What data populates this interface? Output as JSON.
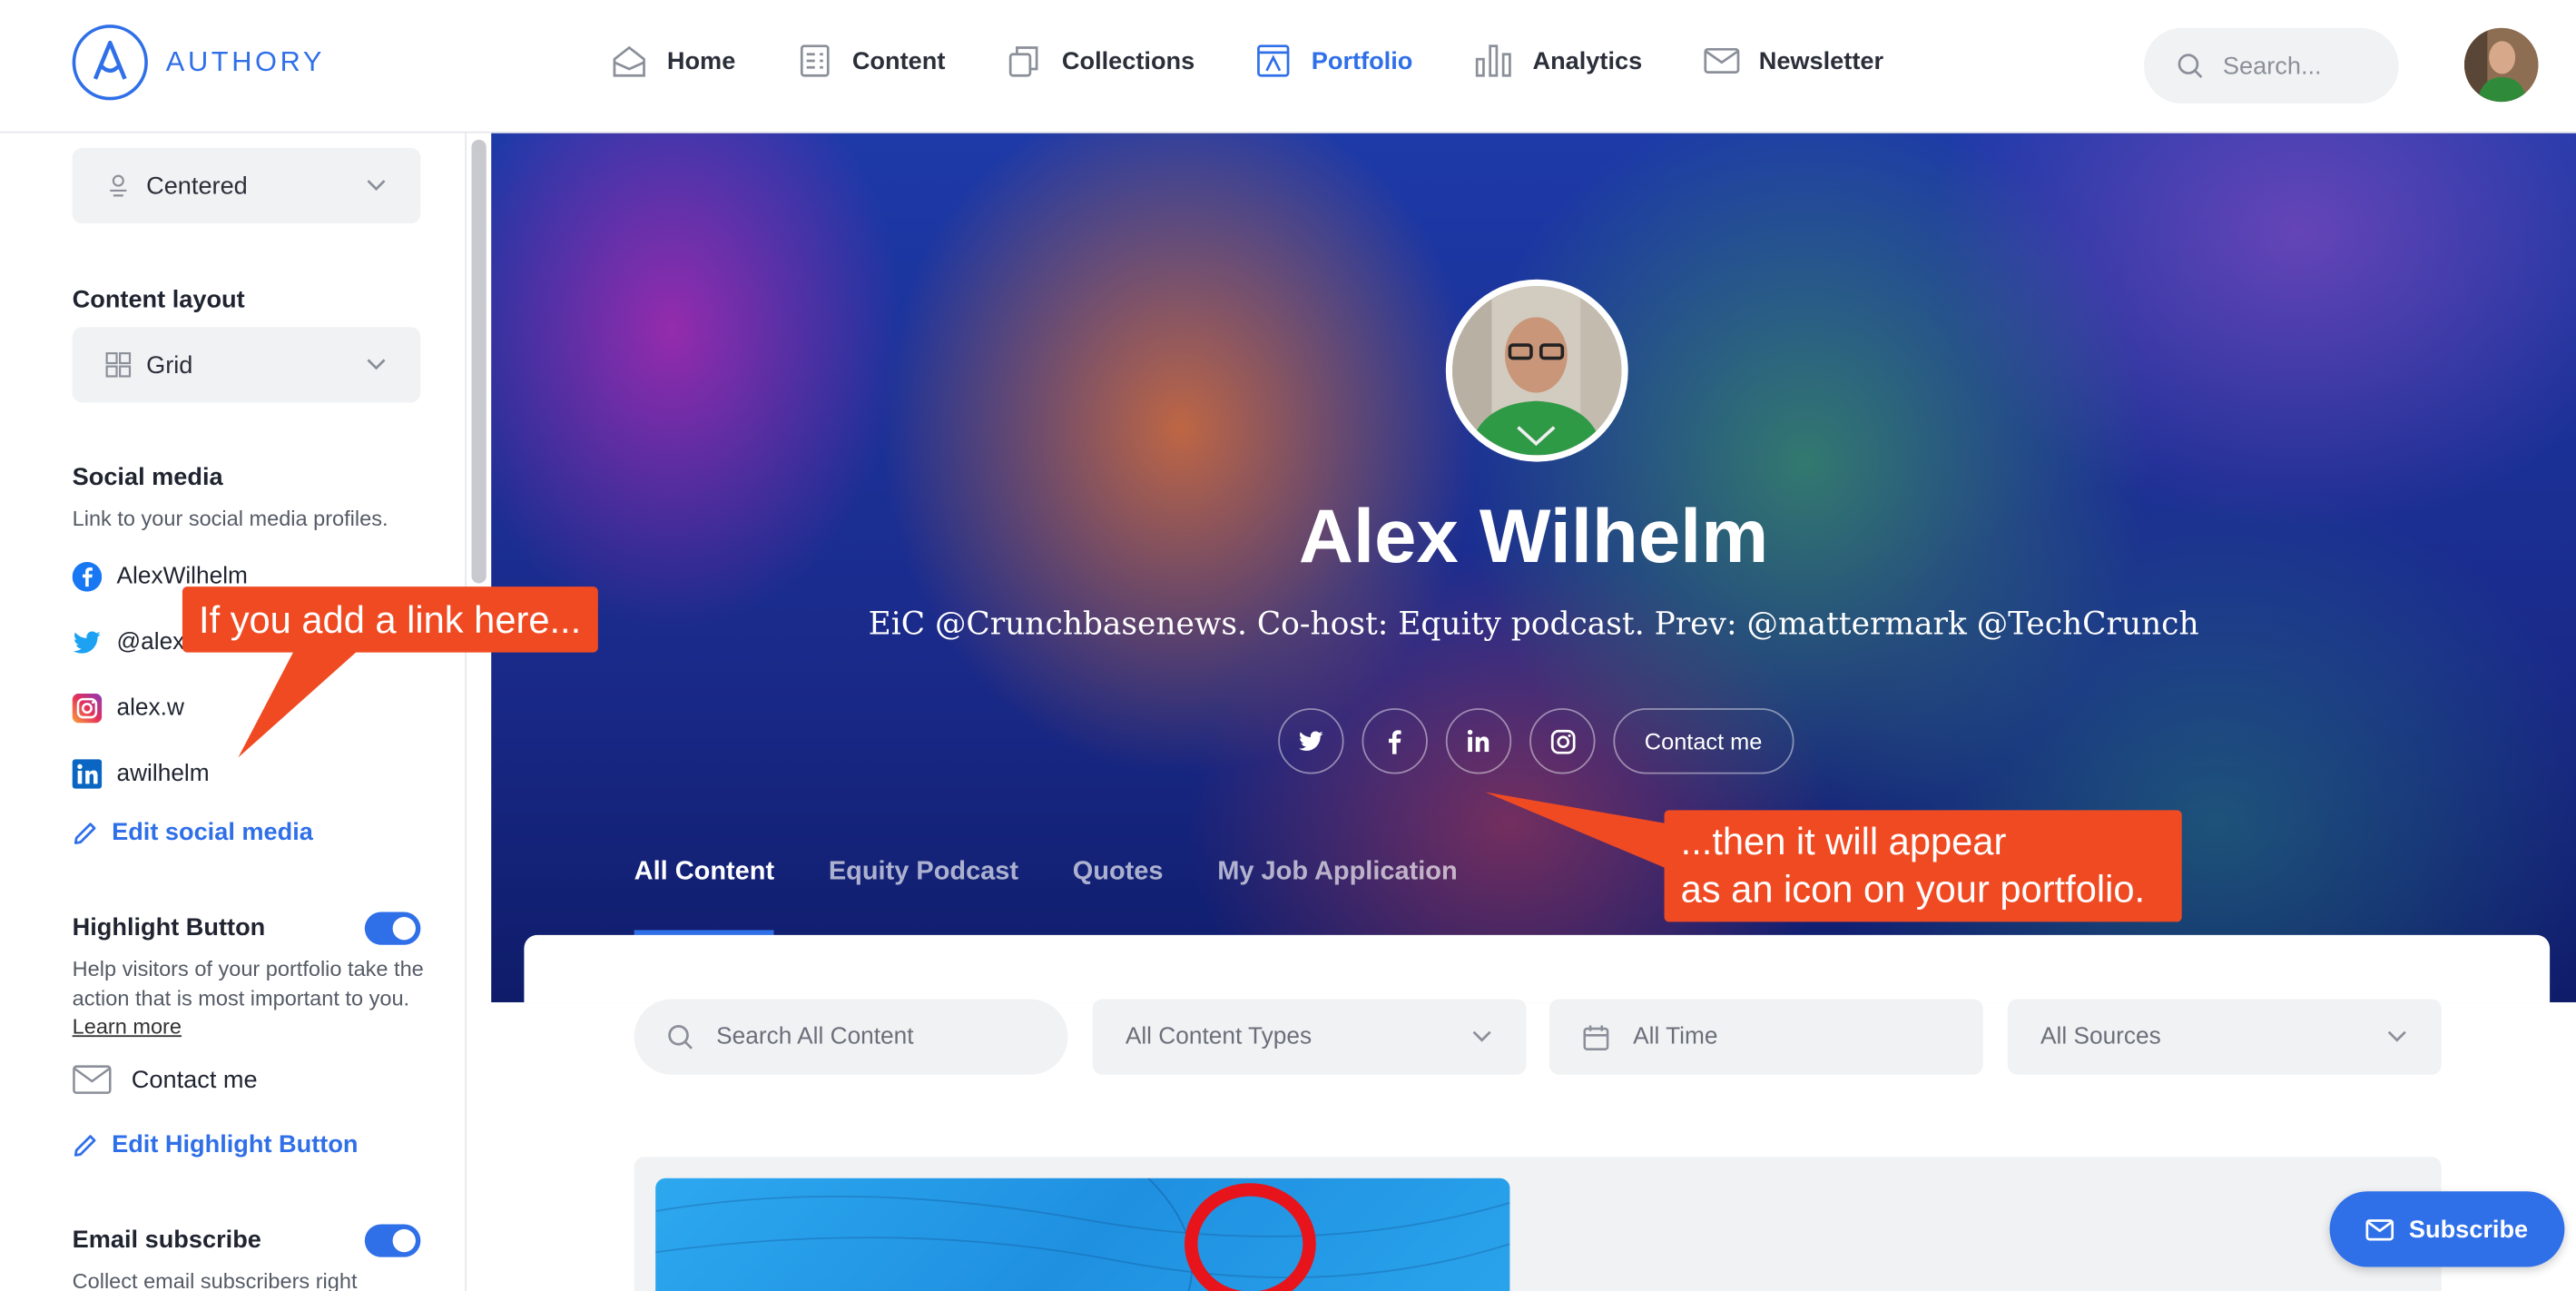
{
  "app": {
    "brand": "AUTHORY",
    "accent_color": "#2f6fe8",
    "annotation_color": "#f04a23"
  },
  "nav": {
    "items": [
      {
        "label": "Home",
        "icon": "home-icon",
        "active": false
      },
      {
        "label": "Content",
        "icon": "content-icon",
        "active": false
      },
      {
        "label": "Collections",
        "icon": "collections-icon",
        "active": false
      },
      {
        "label": "Portfolio",
        "icon": "portfolio-icon",
        "active": true
      },
      {
        "label": "Analytics",
        "icon": "analytics-icon",
        "active": false
      },
      {
        "label": "Newsletter",
        "icon": "newsletter-icon",
        "active": false
      }
    ],
    "search_placeholder": "Search..."
  },
  "sidebar": {
    "header_layout_value": "Centered",
    "content_layout_title": "Content layout",
    "content_layout_value": "Grid",
    "social_title": "Social media",
    "social_sub": "Link to your social media profiles.",
    "social_profiles": [
      {
        "network": "facebook",
        "handle": "AlexWilhelm"
      },
      {
        "network": "twitter",
        "handle": "@alex"
      },
      {
        "network": "instagram",
        "handle": "alex.w"
      },
      {
        "network": "linkedin",
        "handle": "awilhelm"
      }
    ],
    "edit_social_label": "Edit social media",
    "highlight_title": "Highlight Button",
    "highlight_enabled": true,
    "highlight_sub": "Help visitors of your portfolio take the action that is most important to you.",
    "learn_more": "Learn more",
    "highlight_value": "Contact me",
    "edit_highlight_label": "Edit Highlight Button",
    "email_title": "Email subscribe",
    "email_enabled": true,
    "email_sub": "Collect email subscribers right"
  },
  "hero": {
    "name": "Alex Wilhelm",
    "bio": "EiC @Crunchbasenews. Co-host: Equity podcast. Prev: @mattermark @TechCrunch",
    "social_icons": [
      "twitter-icon",
      "facebook-icon",
      "linkedin-icon",
      "instagram-icon"
    ],
    "contact_label": "Contact me",
    "tabs": [
      {
        "label": "All Content",
        "active": true
      },
      {
        "label": "Equity Podcast",
        "active": false
      },
      {
        "label": "Quotes",
        "active": false
      },
      {
        "label": "My Job Application",
        "active": false
      }
    ]
  },
  "filters": {
    "search_placeholder": "Search All Content",
    "content_types": "All Content Types",
    "time": "All Time",
    "sources": "All Sources"
  },
  "subscribe_label": "Subscribe",
  "annotations": {
    "left": "If you add a link here...",
    "right_line1": "...then it will appear",
    "right_line2": "as an icon on your portfolio."
  }
}
